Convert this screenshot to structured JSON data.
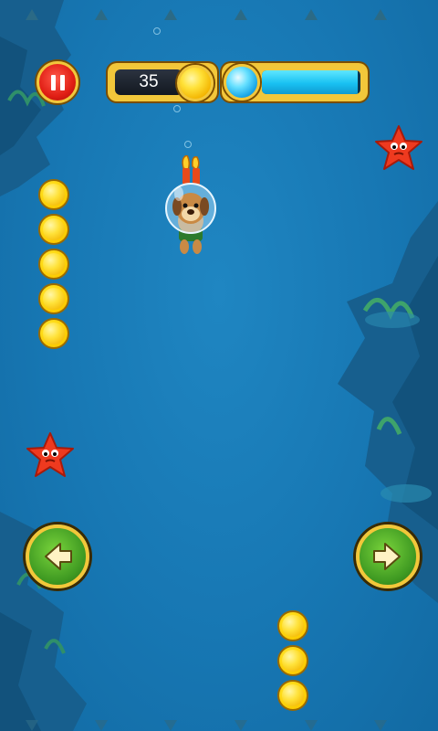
{
  "hud": {
    "score": "35",
    "air_level": 0.97,
    "pause_icon": "pause-icon",
    "score_icon": "coin-icon",
    "air_icon": "bubble-icon"
  },
  "controls": {
    "left_icon": "arrow-left-icon",
    "right_icon": "arrow-right-icon"
  },
  "scene": {
    "player": "dog-diver-with-bubble-helmet",
    "enemies": [
      "red-starfish",
      "red-starfish"
    ],
    "coin_groups": [
      5,
      3
    ]
  },
  "colors": {
    "water": "#1a7cb8",
    "gold_frame": "#f2c73a",
    "pause_red": "#e01e14",
    "control_green": "#3f9a22",
    "air_cyan": "#19c1f2"
  }
}
